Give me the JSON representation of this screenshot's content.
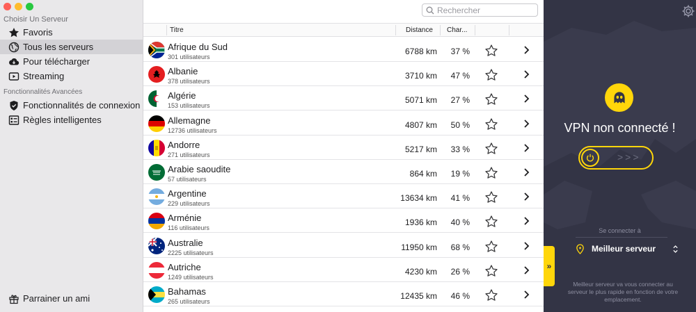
{
  "sidebar": {
    "section1_title": "Choisir Un Serveur",
    "items": [
      {
        "label": "Favoris",
        "icon": "star-icon"
      },
      {
        "label": "Tous les serveurs",
        "icon": "globe-icon"
      },
      {
        "label": "Pour télécharger",
        "icon": "cloud-download-icon"
      },
      {
        "label": "Streaming",
        "icon": "play-icon"
      }
    ],
    "section2_title": "Fonctionnalités Avancées",
    "advanced": [
      {
        "label": "Fonctionnalités de connexion",
        "icon": "shield-icon"
      },
      {
        "label": "Règles intelligentes",
        "icon": "rules-icon"
      }
    ],
    "footer_label": "Parrainer un ami",
    "footer_icon": "gift-icon"
  },
  "search": {
    "placeholder": "Rechercher"
  },
  "columns": {
    "title": "Titre",
    "distance": "Distance",
    "load": "Char..."
  },
  "rows": [
    {
      "name": "Afrique du Sud",
      "users": "301 utilisateurs",
      "distance": "6788 km",
      "load": "37 %",
      "flag": "za"
    },
    {
      "name": "Albanie",
      "users": "378 utilisateurs",
      "distance": "3710 km",
      "load": "47 %",
      "flag": "al"
    },
    {
      "name": "Algérie",
      "users": "153 utilisateurs",
      "distance": "5071 km",
      "load": "27 %",
      "flag": "dz"
    },
    {
      "name": "Allemagne",
      "users": "12736 utilisateurs",
      "distance": "4807 km",
      "load": "50 %",
      "flag": "de"
    },
    {
      "name": "Andorre",
      "users": "271 utilisateurs",
      "distance": "5217 km",
      "load": "33 %",
      "flag": "ad"
    },
    {
      "name": "Arabie saoudite",
      "users": "57 utilisateurs",
      "distance": "864 km",
      "load": "19 %",
      "flag": "sa"
    },
    {
      "name": "Argentine",
      "users": "229 utilisateurs",
      "distance": "13634 km",
      "load": "41 %",
      "flag": "ar"
    },
    {
      "name": "Arménie",
      "users": "116 utilisateurs",
      "distance": "1936 km",
      "load": "40 %",
      "flag": "am"
    },
    {
      "name": "Australie",
      "users": "2225 utilisateurs",
      "distance": "11950 km",
      "load": "68 %",
      "flag": "au"
    },
    {
      "name": "Autriche",
      "users": "1249 utilisateurs",
      "distance": "4230 km",
      "load": "26 %",
      "flag": "at"
    },
    {
      "name": "Bahamas",
      "users": "265 utilisateurs",
      "distance": "12435 km",
      "load": "46 %",
      "flag": "bs"
    }
  ],
  "panel": {
    "status": "VPN non connecté !",
    "connect_label": "Se connecter à",
    "server": "Meilleur serveur",
    "description": "Meilleur serveur va vous connecter au serveur le plus rapide en fonction de votre emplacement.",
    "accent": "#ffd60a",
    "background": "#333445"
  }
}
